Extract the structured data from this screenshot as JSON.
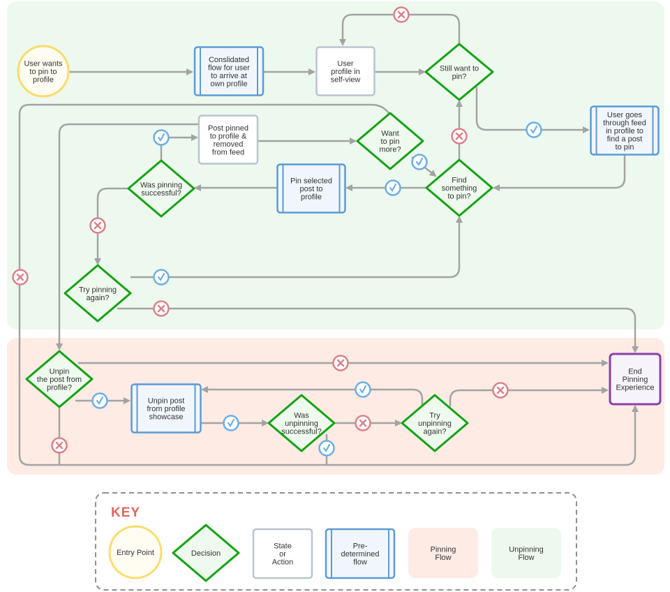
{
  "colors": {
    "unpinning_region": "#edf9ee",
    "pinning_region": "#fdebe4",
    "edge": "#a3a3a3",
    "entry_stroke": "#fbdc6a",
    "entry_fill": "#fffdf2",
    "decision_stroke": "#12a312",
    "decision_fill": "#effaef",
    "state_stroke": "#b9c4d0",
    "predetermined_stroke": "#5b9bd5",
    "predetermined_fill": "#f1f6fd",
    "end_stroke": "#8a3fb0",
    "check": "#6aaee8",
    "cross": "#dd8088",
    "key_title": "#e2675a"
  },
  "nodes": [
    {
      "id": "entry",
      "type": "entry",
      "lines": [
        "User wants",
        "to pin to",
        "profile"
      ]
    },
    {
      "id": "consolidated",
      "type": "predetermined",
      "lines": [
        "Conslidated",
        "flow for user",
        "to arrive at",
        "own profile"
      ]
    },
    {
      "id": "self_view",
      "type": "state",
      "lines": [
        "User",
        "profile in",
        "self-view"
      ]
    },
    {
      "id": "still_want",
      "type": "decision",
      "lines": [
        "Still want to",
        "pin?"
      ]
    },
    {
      "id": "goes_feed",
      "type": "predetermined",
      "lines": [
        "User goes",
        "through feed",
        "in profile to",
        "find a post",
        "to pin"
      ]
    },
    {
      "id": "want_more",
      "type": "decision",
      "lines": [
        "Want",
        "to pin",
        "more?"
      ]
    },
    {
      "id": "post_pinned",
      "type": "state",
      "lines": [
        "Post pinned",
        "to profile &",
        "removed",
        "from feed"
      ]
    },
    {
      "id": "find",
      "type": "decision",
      "lines": [
        "Find",
        "something",
        "to pin?"
      ]
    },
    {
      "id": "pin_selected",
      "type": "predetermined",
      "lines": [
        "Pin selected",
        "post to",
        "profile"
      ]
    },
    {
      "id": "was_pinning",
      "type": "decision",
      "lines": [
        "Was pinning",
        "successful?"
      ]
    },
    {
      "id": "try_pinning",
      "type": "decision",
      "lines": [
        "Try pinning",
        "again?"
      ]
    },
    {
      "id": "unpin_q",
      "type": "decision",
      "lines": [
        "Unpin",
        "the post from",
        "profile?"
      ]
    },
    {
      "id": "unpin_post",
      "type": "predetermined",
      "lines": [
        "Unpin post",
        "from profile",
        "showcase"
      ]
    },
    {
      "id": "was_unpinning",
      "type": "decision",
      "lines": [
        "Was",
        "unpinning",
        "successful?"
      ]
    },
    {
      "id": "try_unpinning",
      "type": "decision",
      "lines": [
        "Try",
        "unpinning",
        "again?"
      ]
    },
    {
      "id": "end",
      "type": "end",
      "lines": [
        "End",
        "Pinning",
        "Experience"
      ]
    }
  ],
  "badges": [
    "no",
    "yes",
    "no",
    "yes",
    "yes",
    "yes",
    "no",
    "yes",
    "no",
    "no",
    "no",
    "yes",
    "yes",
    "no",
    "yes",
    "no",
    "yes",
    "no"
  ],
  "key": {
    "title": "KEY",
    "items": [
      {
        "type": "entry",
        "lines": [
          "Entry Point"
        ]
      },
      {
        "type": "decision",
        "lines": [
          "Decision"
        ]
      },
      {
        "type": "state",
        "lines": [
          "State",
          "or",
          "Action"
        ]
      },
      {
        "type": "predetermined",
        "lines": [
          "Pre-",
          "determined",
          "flow"
        ]
      },
      {
        "type": "pinning",
        "lines": [
          "Pinning",
          "Flow"
        ]
      },
      {
        "type": "unpinning",
        "lines": [
          "Unpinning",
          "Flow"
        ]
      }
    ]
  }
}
